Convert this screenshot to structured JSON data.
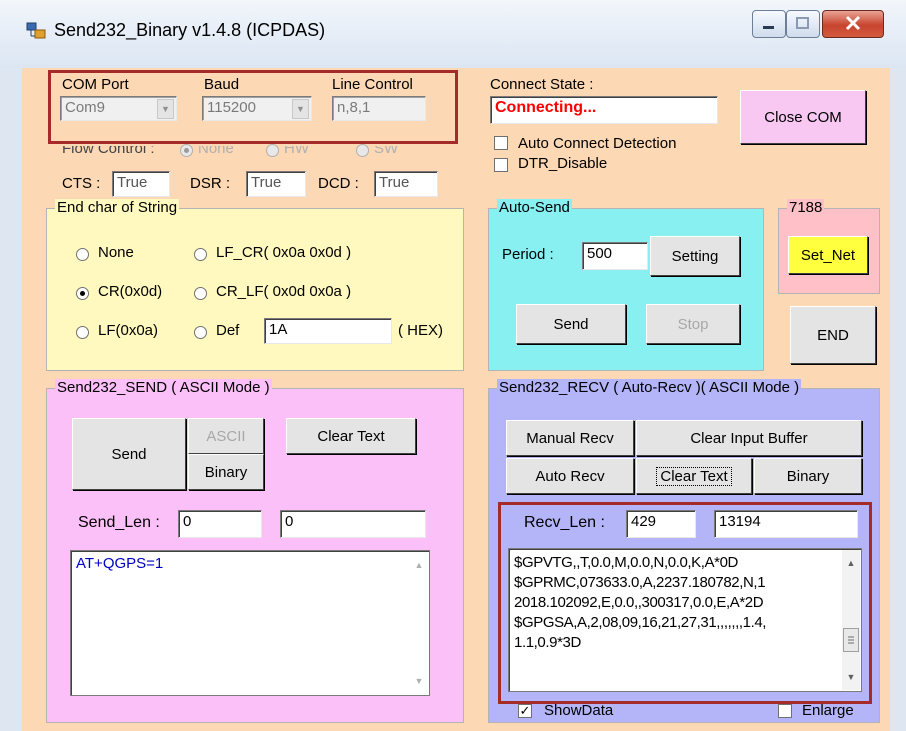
{
  "window": {
    "title": "Send232_Binary v1.4.8 (ICPDAS)",
    "accent": "#a52a2a"
  },
  "com": {
    "port_label": "COM Port",
    "port_value": "Com9",
    "baud_label": "Baud",
    "baud_value": "115200",
    "line_label": "Line Control",
    "line_value": "n,8,1"
  },
  "flow": {
    "label": "Flow Control :",
    "options": [
      "None",
      "HW",
      "SW"
    ],
    "selected": "None"
  },
  "signals": {
    "cts_label": "CTS :",
    "cts_value": "True",
    "dsr_label": "DSR :",
    "dsr_value": "True",
    "dcd_label": "DCD :",
    "dcd_value": "True"
  },
  "connect": {
    "label": "Connect State :",
    "value": "Connecting...",
    "value_color": "#ff0000",
    "close_label": "Close COM",
    "auto_detect_label": "Auto Connect Detection",
    "dtr_label": "DTR_Disable"
  },
  "endchar": {
    "title": "End char of String",
    "none": "None",
    "lf_cr": "LF_CR( 0x0a 0x0d )",
    "cr": "CR(0x0d)",
    "cr_lf": "CR_LF( 0x0d 0x0a )",
    "lf": "LF(0x0a)",
    "def": "Def",
    "def_value": "1A",
    "hex": "( HEX)",
    "selected": "CR(0x0d)"
  },
  "autosend": {
    "title": "Auto-Send",
    "period_label": "Period :",
    "period_value": "500",
    "setting": "Setting",
    "send": "Send",
    "stop": "Stop"
  },
  "net": {
    "title": "7188",
    "set_net": "Set_Net",
    "end": "END"
  },
  "send_panel": {
    "title": "Send232_SEND ( ASCII Mode )",
    "send": "Send",
    "ascii": "ASCII",
    "binary": "Binary",
    "clear": "Clear Text",
    "len_label": "Send_Len :",
    "len1": "0",
    "len2": "0",
    "text": "AT+QGPS=1"
  },
  "recv_panel": {
    "title": "Send232_RECV ( Auto-Recv )( ASCII Mode )",
    "manual": "Manual Recv",
    "clear_input": "Clear Input Buffer",
    "auto": "Auto Recv",
    "clear_text": "Clear Text",
    "binary": "Binary",
    "len_label": "Recv_Len :",
    "len1": "429",
    "len2": "13194",
    "lines": [
      "$GPVTG,,T,0.0,M,0.0,N,0.0,K,A*0D",
      "$GPRMC,073633.0,A,2237.180782,N,1",
      "2018.102092,E,0.0,,300317,0.0,E,A*2D",
      "$GPGSA,A,2,08,09,16,21,27,31,,,,,,,1.4,",
      "1.1,0.9*3D"
    ],
    "show_data": "ShowData",
    "enlarge": "Enlarge"
  }
}
